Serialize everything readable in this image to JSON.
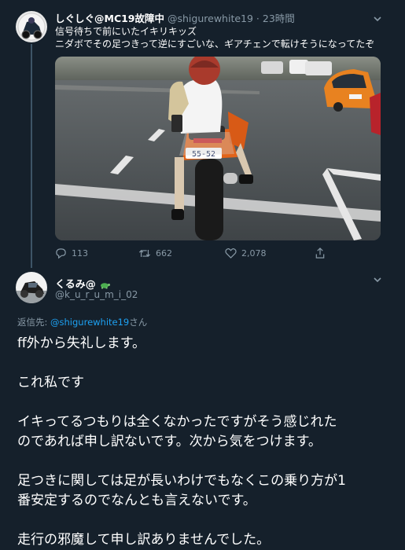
{
  "tweet1": {
    "display_name": "しぐしぐ@MC19故障中",
    "handle": "@shigurewhite19",
    "separator": "·",
    "time": "23時間",
    "text_line1": "信号待ちで前にいたイキリキッズ",
    "text_line2": "ニダボでその足つきって逆にすごいな、ギアチェンで転けそうになってたぞ",
    "photo_plate": "55-52",
    "actions": {
      "reply_count": "113",
      "retweet_count": "662",
      "like_count": "2,078"
    }
  },
  "tweet2": {
    "display_name": "くるみ@",
    "handle": "@k_u_r_u_m_i_02",
    "reply_prefix": "返信先: ",
    "reply_mention": "@shigurewhite19",
    "reply_suffix": "さん",
    "lines": [
      "ff外から失礼します。",
      "",
      "これ私です",
      "",
      "イキってるつもりは全くなかったですがそう感じれた",
      "のであれば申し訳ないです。次から気をつけます。",
      "",
      "足つきに関しては足が長いわけでもなくこの乗り方が1",
      "番安定するのでなんとも言えないです。",
      "",
      "走行の邪魔して申し訳ありませんでした。"
    ]
  },
  "colors": {
    "background": "#15202b",
    "secondary_text": "#8899a6",
    "link": "#1da1f2",
    "thread_line": "#3d5466"
  },
  "icons": [
    "chevron-down-icon",
    "reply-icon",
    "retweet-icon",
    "like-icon",
    "share-icon",
    "turtle-emoji-icon"
  ]
}
